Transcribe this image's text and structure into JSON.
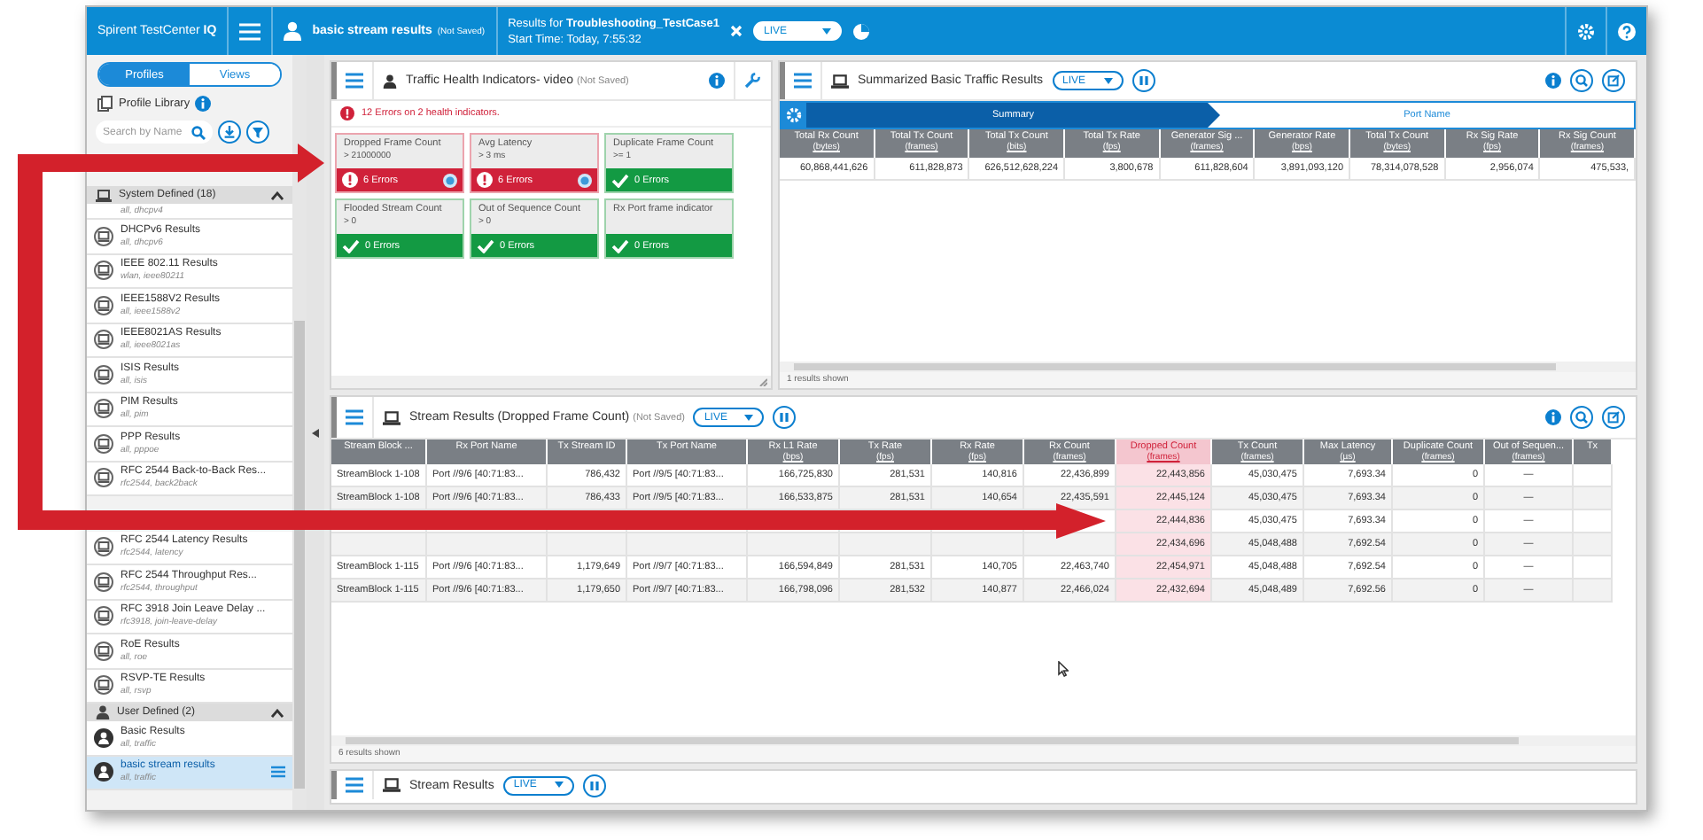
{
  "top_bar": {
    "brand": "Spirent TestCenter **IQ**",
    "view_name": "basic stream results",
    "view_state": "(Not Saved)",
    "results_for": "Results for **Troubleshooting_TestCase1**",
    "start_time": "Start Time: Today, 7:55:32",
    "live": "LIVE"
  },
  "sidebar": {
    "tabs": [
      {
        "label": "Profiles",
        "selected": true
      },
      {
        "label": "Views",
        "selected": false
      }
    ],
    "library_title": "Profile Library",
    "search": {
      "placeholder": "Search by Name"
    },
    "groups": [
      {
        "kind": "system",
        "label": "System Defined (18)",
        "expanded": true,
        "items": [
          {
            "kind": "tags_only",
            "subtitle": "all, dhcpv4"
          },
          {
            "title": "DHCPv6 Results",
            "subtitle": "all, dhcpv6",
            "selected": false
          },
          {
            "title": "IEEE 802.11 Results",
            "subtitle": "wlan, ieee80211",
            "selected": false
          },
          {
            "title": "IEEE1588V2 Results",
            "subtitle": "all, ieee1588v2",
            "selected": false
          },
          {
            "title": "IEEE8021AS Results",
            "subtitle": "all, ieee8021as",
            "selected": false
          },
          {
            "title": "ISIS Results",
            "subtitle": "all, isis",
            "selected": false
          },
          {
            "title": "PIM Results",
            "subtitle": "all, pim",
            "selected": false
          },
          {
            "title": "PPP Results",
            "subtitle": "all, pppoe",
            "selected": false
          },
          {
            "title": "RFC 2544 Back-to-Back Res...",
            "subtitle": "rfc2544, back2back",
            "selected": false
          },
          {
            "kind": "covered"
          },
          {
            "title": "RFC 2544 Latency Results",
            "subtitle": "rfc2544, latency",
            "selected": false
          },
          {
            "title": "RFC 2544 Throughput Res...",
            "subtitle": "rfc2544, throughput",
            "selected": false
          },
          {
            "title": "RFC 3918 Join Leave Delay ...",
            "subtitle": "rfc3918, join-leave-delay",
            "selected": false
          },
          {
            "title": "RoE Results",
            "subtitle": "all, roe",
            "selected": false
          },
          {
            "title": "RSVP-TE Results",
            "subtitle": "all, rsvp",
            "selected": false
          }
        ]
      },
      {
        "kind": "user",
        "label": "User Defined (2)",
        "expanded": true,
        "items": [
          {
            "title": "Basic Results",
            "subtitle": "all, traffic",
            "selected": false
          },
          {
            "title": "basic stream results",
            "subtitle": "all, traffic",
            "selected": true
          }
        ]
      }
    ]
  },
  "health_panel": {
    "title": "Traffic Health Indicators- video",
    "state": "(Not Saved)",
    "message": "12 Errors on 2 health indicators.",
    "cards": [
      {
        "title": "Dropped Frame Count",
        "threshold": "> 21000000",
        "failed": true,
        "result": "6 Errors"
      },
      {
        "title": "Avg Latency",
        "threshold": "> 3 ms",
        "failed": true,
        "result": "6 Errors"
      },
      {
        "title": "Duplicate Frame Count",
        "threshold": ">= 1",
        "failed": false,
        "result": "0 Errors"
      },
      {
        "title": "Flooded Stream Count",
        "threshold": "> 0",
        "failed": false,
        "result": "0 Errors"
      },
      {
        "title": "Out of Sequence Count",
        "threshold": "> 0",
        "failed": false,
        "result": "0 Errors"
      },
      {
        "title": "Rx Port frame indicator",
        "failed": false,
        "result": "0 Errors"
      }
    ]
  },
  "summary_panel": {
    "title": "Summarized Basic Traffic Results",
    "live": "LIVE",
    "tabs": [
      {
        "label": "Summary",
        "selected": true
      },
      {
        "label": "Port Name",
        "selected": false
      }
    ],
    "columns": [
      {
        "name": "Total Rx Count",
        "unit": "(bytes)"
      },
      {
        "name": "Total Tx Count",
        "unit": "(frames)"
      },
      {
        "name": "Total Tx Count",
        "unit": "(bits)"
      },
      {
        "name": "Total Tx Rate",
        "unit": "(fps)"
      },
      {
        "name": "Generator Sig ...",
        "unit": "(frames)"
      },
      {
        "name": "Generator Rate",
        "unit": "(bps)"
      },
      {
        "name": "Total Tx Count",
        "unit": "(bytes)"
      },
      {
        "name": "Rx Sig Rate",
        "unit": "(fps)"
      },
      {
        "name": "Rx Sig Count",
        "unit": "(frames)"
      }
    ],
    "rows": [
      [
        "60,868,441,626",
        "611,828,873",
        "626,512,628,224",
        "3,800,678",
        "611,828,604",
        "3,891,093,120",
        "78,314,078,528",
        "2,956,074",
        "475,533,"
      ]
    ],
    "footer": "1 results shown"
  },
  "stream_panel": {
    "title": "Stream Results (Dropped Frame Count)",
    "state": "(Not Saved)",
    "live": "LIVE",
    "columns": [
      {
        "name": "Stream Block ...",
        "highlighted": false
      },
      {
        "name": "Rx Port Name",
        "highlighted": false
      },
      {
        "name": "Tx Stream ID",
        "highlighted": false
      },
      {
        "name": "Tx Port Name",
        "highlighted": false
      },
      {
        "name": "Rx L1 Rate",
        "unit": "(bps)",
        "highlighted": false
      },
      {
        "name": "Tx Rate",
        "unit": "(fps)",
        "highlighted": false
      },
      {
        "name": "Rx Rate",
        "unit": "(fps)",
        "highlighted": false
      },
      {
        "name": "Rx Count",
        "unit": "(frames)",
        "highlighted": false
      },
      {
        "name": "Dropped Count",
        "unit": "(frames)",
        "highlighted": true
      },
      {
        "name": "Tx Count",
        "unit": "(frames)",
        "highlighted": false
      },
      {
        "name": "Max Latency",
        "unit": "(µs)",
        "highlighted": false
      },
      {
        "name": "Duplicate Count",
        "unit": "(frames)",
        "highlighted": false
      },
      {
        "name": "Out of Sequen...",
        "unit": "(frames)",
        "highlighted": false
      },
      {
        "name": "Tx",
        "highlighted": false
      }
    ],
    "rows": [
      {
        "covered": false,
        "cells": [
          "StreamBlock 1-108",
          "Port //9/6 [40:71:83...",
          "786,432",
          "Port //9/5 [40:71:83...",
          "166,725,830",
          "281,531",
          "140,816",
          "22,436,899",
          "22,443,856",
          "45,030,475",
          "7,693.34",
          "0",
          "—"
        ]
      },
      {
        "covered": false,
        "cells": [
          "StreamBlock 1-108",
          "Port //9/6 [40:71:83...",
          "786,433",
          "Port //9/5 [40:71:83...",
          "166,533,875",
          "281,531",
          "140,654",
          "22,435,591",
          "22,445,124",
          "45,030,475",
          "7,693.34",
          "0",
          "—"
        ]
      },
      {
        "covered": true,
        "cells": [
          "22,444,836",
          "45,030,475",
          "7,693.34",
          "0",
          "—"
        ]
      },
      {
        "covered": true,
        "cells": [
          "22,434,696",
          "45,048,488",
          "7,692.54",
          "0",
          "—"
        ]
      },
      {
        "covered": false,
        "cells": [
          "StreamBlock 1-115",
          "Port //9/6 [40:71:83...",
          "1,179,649",
          "Port //9/7 [40:71:83...",
          "166,594,849",
          "281,531",
          "140,705",
          "22,463,740",
          "22,454,971",
          "45,048,488",
          "7,692.54",
          "0",
          "—"
        ]
      },
      {
        "covered": false,
        "cells": [
          "StreamBlock 1-115",
          "Port //9/6 [40:71:83...",
          "1,179,650",
          "Port //9/7 [40:71:83...",
          "166,798,096",
          "281,532",
          "140,877",
          "22,466,024",
          "22,432,694",
          "45,048,489",
          "7,692.56",
          "0",
          "—"
        ]
      }
    ],
    "footer": "6 results shown"
  },
  "bottom_panel": {
    "title": "Stream Results",
    "live": "LIVE"
  }
}
